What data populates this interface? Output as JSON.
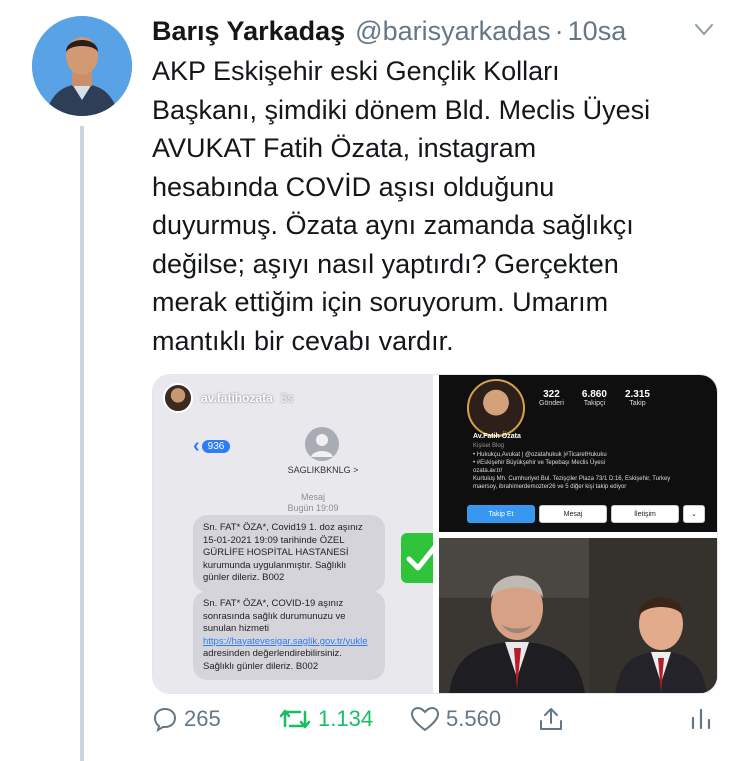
{
  "tweet": {
    "author_name": "Barış Yarkadaş",
    "author_handle": "@barisyarkadas",
    "separator": "·",
    "time": "10sa",
    "text_lines": [
      "AKP Eskişehir eski Gençlik Kolları",
      "Başkanı, şimdiki dönem Bld. Meclis Üyesi",
      "AVUKAT Fatih Özata, instagram",
      "hesabında COVİD aşısı olduğunu",
      "duyurmuş. Özata aynı zamanda sağlıkçı",
      "değilse; aşıyı nasıl yaptırdı? Gerçekten",
      "merak ettiğim için soruyorum. Umarım",
      "mantıklı bir cevabı vardır."
    ]
  },
  "media_left": {
    "story_user": "av.fatihozata",
    "story_age": "3s",
    "badge_count": "936",
    "contact_name": "SAGLIKBKNLG >",
    "msg_label": "Mesaj",
    "msg_date": "Bugün 19:09",
    "bubble1": "Sn. FAT* ÖZA*, Covid19 1. doz aşınız 15-01-2021 19:09 tarihinde ÖZEL GÜRLİFE HOSPİTAL HASTANESİ kurumunda uygulanmıştır. Sağlıklı günler dileriz. B002",
    "bubble2_text": "Sn. FAT* ÖZA*, COVID-19 aşınız sonrasında sağlık durumunuzu ve sunulan hizmeti",
    "bubble2_link": "https://hayatevesigar.saglik.gov.tr/yukle",
    "bubble2_tail": "adresinden değerlendirebilirsiniz. Sağlıklı günler dileriz. B002"
  },
  "media_instagram": {
    "stats": [
      {
        "number": "322",
        "label": "Gönderi"
      },
      {
        "number": "6.860",
        "label": "Takipçi"
      },
      {
        "number": "2.315",
        "label": "Takip"
      }
    ],
    "profile_name": "Av.Fatih Özata",
    "category": "Kişisel Blog",
    "bio_lines": [
      "• Hukukçu,Avukat | @ozatahukuk |#TicaretHukuku",
      "• #Eskişehir Büyükşehir ve Tepebaşı Meclis Üyesi",
      "ozata.av.tr/",
      "Kurtuluş Mh. Cumhuriyet Bul. Tezişçiler Plaza 73/1 D:16, Eskişehir, Turkey",
      "maersoy, ibrahimerdemozter26 ve 5 diğer kişi takip ediyor"
    ],
    "follow_label": "Takip Et",
    "message_label": "Mesaj",
    "contact_label": "İletişim",
    "more_label": "⌄"
  },
  "actions": {
    "reply_count": "265",
    "retweet_count": "1.134",
    "like_count": "5.560"
  },
  "colors": {
    "retweet_green": "#17bf63",
    "muted_gray": "#657786",
    "thread_line": "#ccd6dd"
  }
}
